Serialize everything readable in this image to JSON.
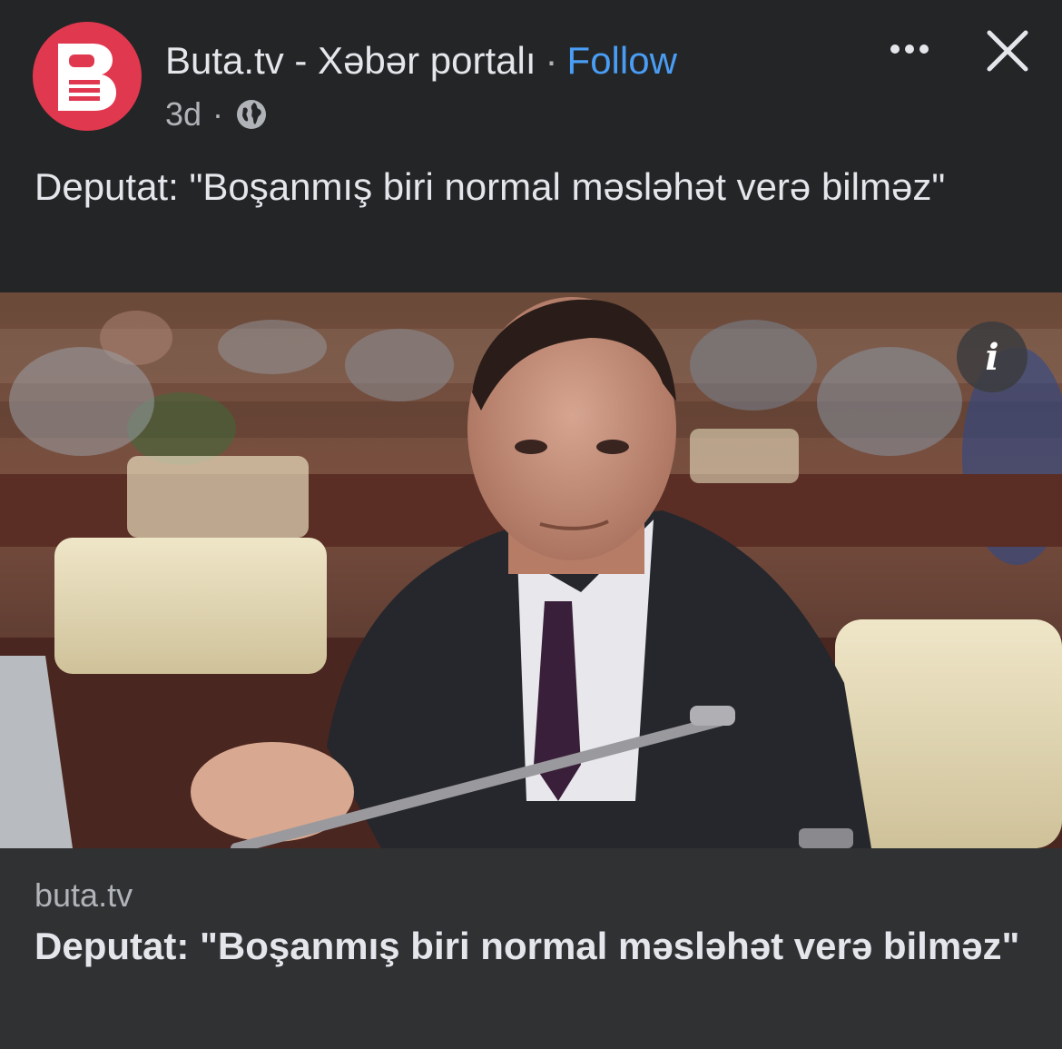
{
  "post": {
    "page_name": "Buta.tv - Xəbər portalı",
    "separator": "·",
    "follow_label": "Follow",
    "age": "3d",
    "meta_dot": "·",
    "audience_icon": "globe-icon",
    "text": "Deputat: \"Boşanmış biri normal məsləhət verə bilməz\""
  },
  "avatar": {
    "icon": "buta-logo-icon",
    "color": "#e0384f"
  },
  "actions": {
    "more_icon": "more-dots-icon",
    "close_icon": "close-icon",
    "info_icon": "info-icon",
    "info_glyph": "i"
  },
  "link_preview": {
    "domain": "buta.tv",
    "title": "Deputat: \"Boşanmış biri normal məsləhət verə bilməz\""
  },
  "colors": {
    "background": "#242526",
    "link_card": "#303133",
    "follow": "#4a9df5",
    "secondary_text": "#b0b3b8"
  }
}
